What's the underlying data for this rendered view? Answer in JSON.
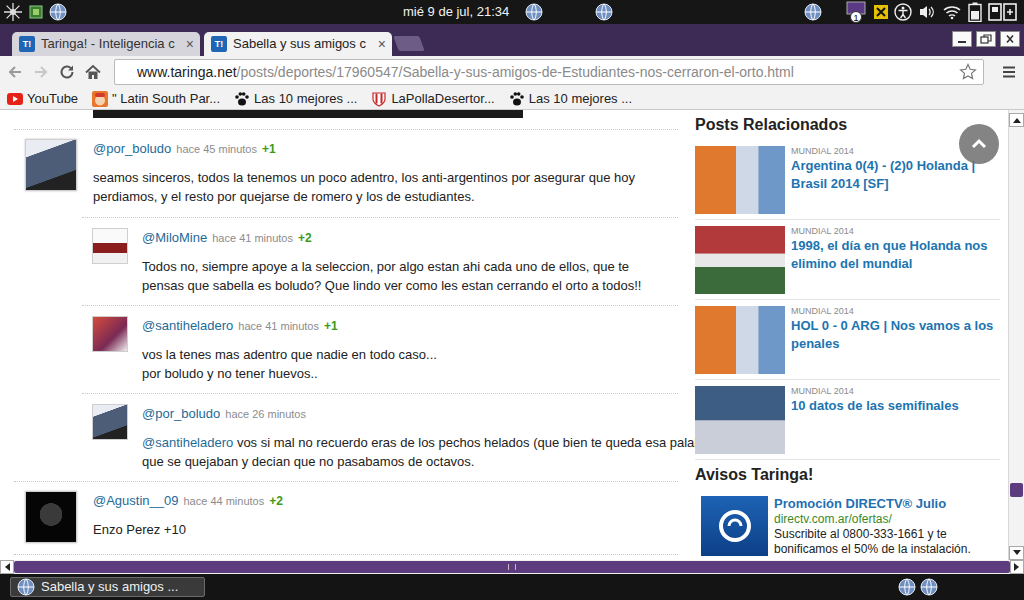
{
  "system_bar": {
    "clock": "mié 9 de jul, 21:34",
    "badge": "1"
  },
  "browser": {
    "tabs": [
      {
        "icon": "T!",
        "label": "Taringa! - Inteligencia c",
        "close": "×",
        "selected": false
      },
      {
        "icon": "T!",
        "label": "Sabella y sus amigos c",
        "close": "×",
        "selected": true
      }
    ],
    "url": {
      "host": "www.taringa.net",
      "path": "/posts/deportes/17960547/Sabella-y-sus-amigos-de-Estudiantes-nos-cerraron-el-orto.html"
    },
    "bookmarks": [
      {
        "label": "YouTube",
        "kind": "youtube"
      },
      {
        "label": "\" Latin South Par...",
        "kind": "southpark"
      },
      {
        "label": "Las 10 mejores ...",
        "kind": "paw"
      },
      {
        "label": "LaPollaDesertor...",
        "kind": "club"
      },
      {
        "label": "Las 10 mejores ...",
        "kind": "paw"
      }
    ]
  },
  "comments": [
    {
      "user": "@por_boludo",
      "time": "hace 45 minutos",
      "score": "+1",
      "lines": [
        [
          {
            "kind": "text",
            "text": "seamos sinceros, todos la tenemos un poco adentro, los anti-argentinos por asegurar que hoy"
          }
        ],
        [
          {
            "kind": "text",
            "text": "perdiamos, y el resto por quejarse de romero y los de estudiantes."
          }
        ]
      ],
      "replies": [
        {
          "user": "@MiloMine",
          "time": "hace 41 minutos",
          "score": "+2",
          "lines": [
            [
              {
                "kind": "text",
                "text": "Todos no, siempre apoye a la seleccion, por algo estan ahi cada uno de ellos, que te"
              }
            ],
            [
              {
                "kind": "text",
                "text": "pensas que sabella es boludo? Que lindo ver como les estan cerrando el orto a todos!!"
              }
            ]
          ]
        },
        {
          "user": "@santiheladero",
          "time": "hace 41 minutos",
          "score": "+1",
          "lines": [
            [
              {
                "kind": "text",
                "text": "vos la tenes mas adentro que nadie en todo caso..."
              }
            ],
            [
              {
                "kind": "text",
                "text": "por boludo y no tener huevos.."
              }
            ]
          ]
        },
        {
          "user": "@por_boludo",
          "time": "hace 26 minutos",
          "lines": [
            [
              {
                "kind": "mention",
                "text": "@santiheladero"
              },
              {
                "kind": "text",
                "text": " vos si mal no recuerdo eras de los pechos helados (que bien te queda esa palabra "
              },
              {
                "kind": "smiley"
              },
              {
                "kind": "text",
                "text": " )"
              }
            ],
            [
              {
                "kind": "text",
                "text": "que se quejaban y decian que no pasabamos de octavos."
              }
            ]
          ]
        }
      ]
    },
    {
      "user": "@Agustin__09",
      "time": "hace 44 minutos",
      "score": "+2",
      "lines": [
        [
          {
            "kind": "text",
            "text": "Enzo Perez +10"
          }
        ]
      ],
      "replies": []
    }
  ],
  "sidebar": {
    "title": "Posts Relacionados",
    "posts": [
      {
        "category": "MUNDIAL 2014",
        "title": "Argentina 0(4) - (2)0 Holanda | Brasil 2014 [SF]"
      },
      {
        "category": "MUNDIAL 2014",
        "title": "1998, el día en que Holanda nos elimino del mundial"
      },
      {
        "category": "MUNDIAL 2014",
        "title": "HOL 0 - 0 ARG | Nos vamos a los penales"
      },
      {
        "category": "MUNDIAL 2014",
        "title": "10 datos de las semifinales"
      }
    ],
    "ads_title": "Avisos Taringa!",
    "ad": {
      "title": "Promoción DIRECTV® Julio",
      "url": "directv.com.ar/ofertas/",
      "text": "Suscribite al 0800-333-1661 y te bonificamos el 50% de la instalación."
    }
  },
  "scrollbars": {
    "vertical": {
      "level": 0.88
    }
  },
  "taskbar": {
    "task": "Sabella y sus amigos ..."
  }
}
